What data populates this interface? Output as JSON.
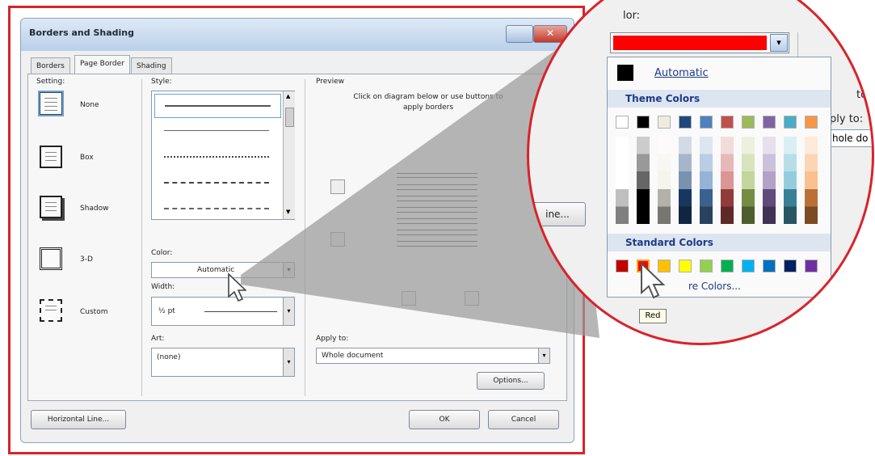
{
  "dialog": {
    "title": "Borders and Shading",
    "tabs": [
      "Borders",
      "Page Border",
      "Shading"
    ],
    "setting_label": "Setting:",
    "settings": [
      "None",
      "Box",
      "Shadow",
      "3-D",
      "Custom"
    ],
    "style_label": "Style:",
    "color_label": "Color:",
    "color_value": "Automatic",
    "width_label": "Width:",
    "width_value": "½ pt",
    "art_label": "Art:",
    "art_value": "(none)",
    "preview_label": "Preview",
    "preview_hint": "Click on diagram below or use buttons to apply borders",
    "apply_to_label": "Apply to:",
    "apply_to_value": "Whole document",
    "options_button": "Options...",
    "horizontal_line_button": "Horizontal Line...",
    "ok_button": "OK",
    "cancel_button": "Cancel"
  },
  "zoom": {
    "color_label_fragment": "lor:",
    "selected_color": "#ff0000",
    "automatic_label": "Automatic",
    "theme_colors_label": "Theme Colors",
    "standard_colors_label": "Standard Colors",
    "more_colors_label": "More Colors...",
    "more_colors_visible": "re Colors...",
    "tooltip": "Red",
    "side_text_1": "tom",
    "side_text_2": "ply to:",
    "side_text_3": "hole do",
    "side_button": "ine...",
    "theme_colors": [
      "#ffffff",
      "#000000",
      "#eeece1",
      "#1f497d",
      "#4f81bd",
      "#c0504d",
      "#9bbb59",
      "#8064a2",
      "#4bacc6",
      "#f79646"
    ],
    "standard_colors": [
      "#c00000",
      "#ff0000",
      "#ffc000",
      "#ffff00",
      "#92d050",
      "#00b050",
      "#00b0f0",
      "#0070c0",
      "#002060",
      "#7030a0"
    ]
  },
  "colors": {
    "frame_red": "#d9232a",
    "overlay_gray": "#9a9a9a",
    "accent_blue": "#6aa3d8"
  }
}
